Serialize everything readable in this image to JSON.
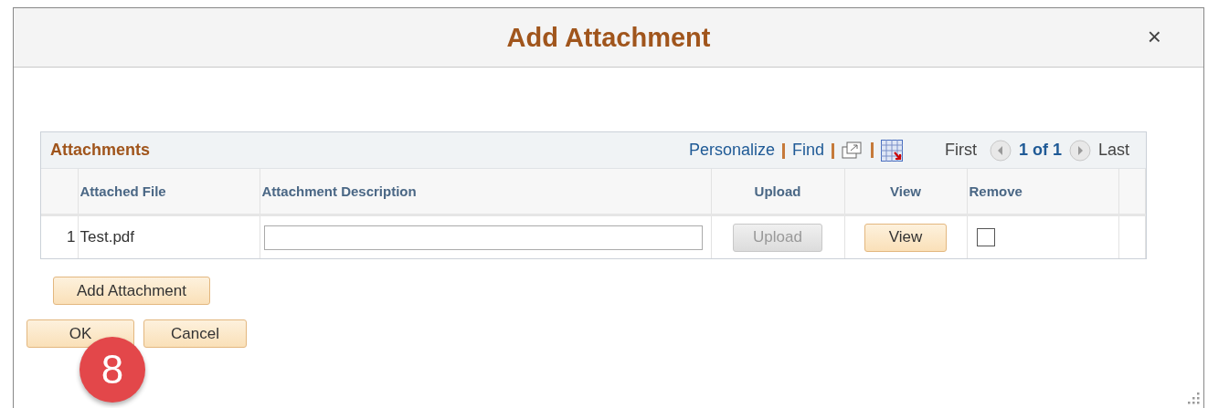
{
  "dialog": {
    "title": "Add Attachment",
    "close": "×"
  },
  "grid": {
    "title": "Attachments",
    "links": [
      "Personalize",
      "Find"
    ],
    "nav": {
      "first": "First",
      "page": "1 of 1",
      "last": "Last"
    },
    "columns": [
      "",
      "Attached File",
      "Attachment Description",
      "Upload",
      "View",
      "Remove"
    ],
    "rows": [
      {
        "row_number": "1",
        "file": "Test.pdf",
        "upload": {
          "label": "Upload",
          "disabled": true
        },
        "view": "View",
        "remove_checked": false
      }
    ]
  },
  "add_button": "Add Attachment",
  "buttons": [
    "OK",
    "Cancel"
  ],
  "step_badge": "8"
}
